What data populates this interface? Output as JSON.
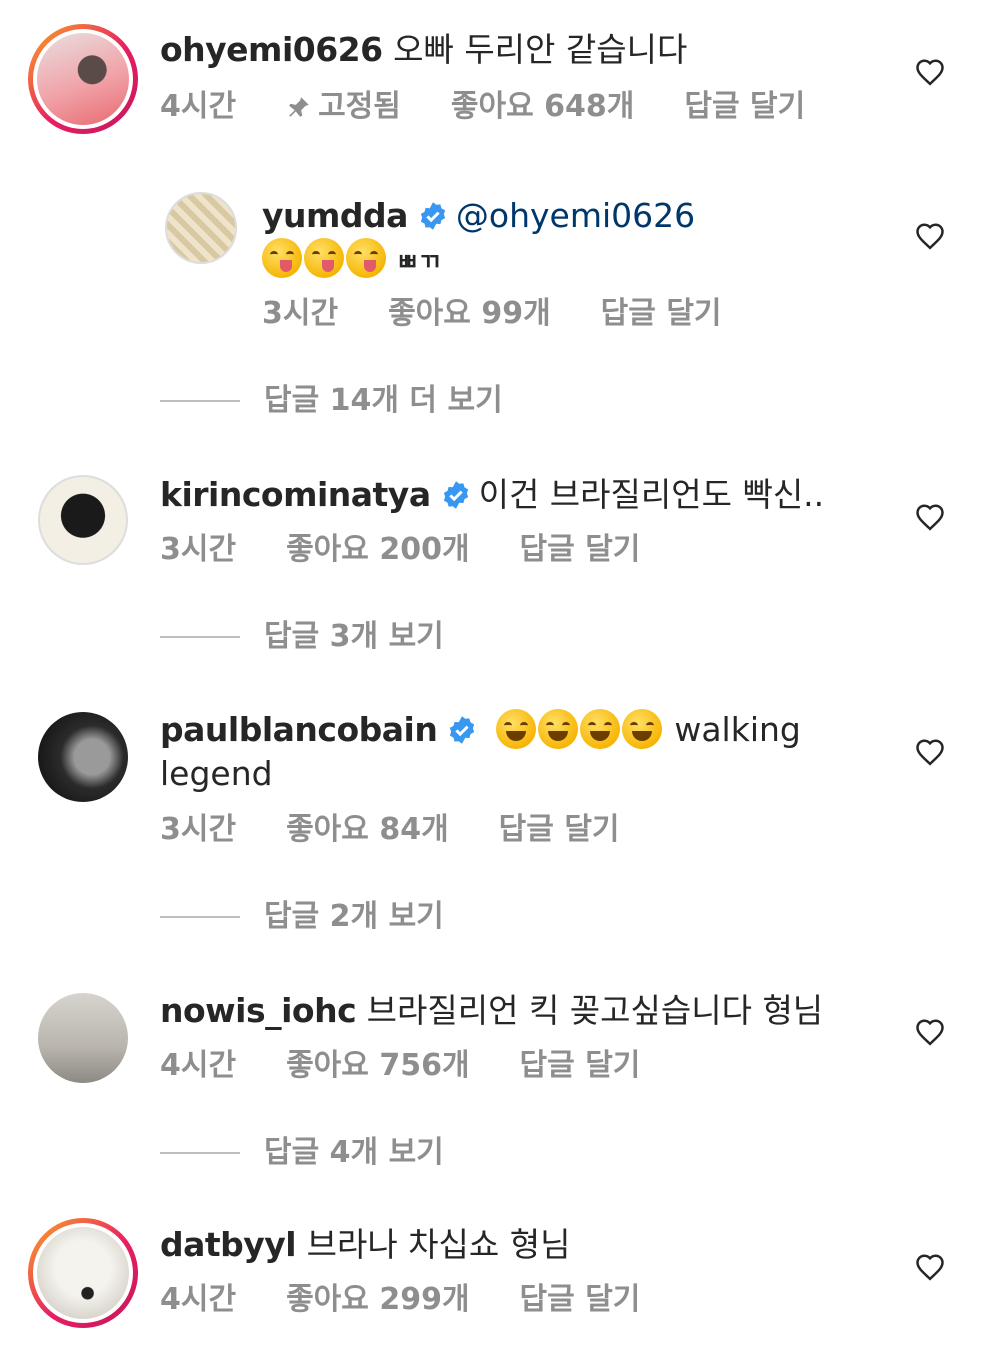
{
  "comments": [
    {
      "username": "ohyemi0626",
      "text": "오빠 두리안 같습니다",
      "time": "4시간",
      "pinned": "고정됨",
      "likes": "좋아요 648개",
      "reply": "답글 달기"
    },
    {
      "username": "yumdda",
      "mention": "@ohyemi0626",
      "text": "ㅃㄲ",
      "time": "3시간",
      "likes": "좋아요 99개",
      "reply": "답글 달기"
    },
    {
      "username": "kirincominatya",
      "text": "이건 브라질리언도 빡신..",
      "time": "3시간",
      "likes": "좋아요 200개",
      "reply": "답글 달기"
    },
    {
      "username": "paulblancobain",
      "text": "walking",
      "text2": "legend",
      "time": "3시간",
      "likes": "좋아요 84개",
      "reply": "답글 달기"
    },
    {
      "username": "nowis_iohc",
      "text": "브라질리언 킥 꽂고싶습니다 형님",
      "time": "4시간",
      "likes": "좋아요 756개",
      "reply": "답글 달기"
    },
    {
      "username": "datbyyl",
      "text": "브라나 차십쇼 형님",
      "time": "4시간",
      "likes": "좋아요 299개",
      "reply": "답글 달기"
    }
  ],
  "view_more": [
    "답글 14개 더 보기",
    "답글 3개 보기",
    "답글 2개 보기",
    "답글 4개 보기"
  ],
  "colors": {
    "verified": "#3897f0",
    "meta": "#8e8e8e",
    "text": "#262626",
    "mention": "#00376b"
  },
  "icons": {
    "heart": "heart-outline-icon",
    "pin": "pin-icon",
    "verified": "verified-badge-icon"
  }
}
